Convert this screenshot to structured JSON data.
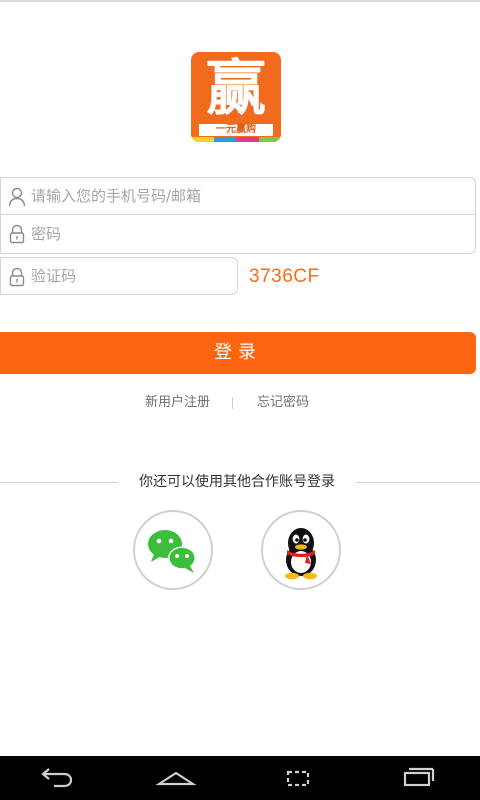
{
  "logo": {
    "char": "赢",
    "subtitle": "一元赢购",
    "color": "#f26b1d",
    "stripe_colors": [
      "#f7d51c",
      "#1fa3e0",
      "#e53a8a",
      "#8bc34a"
    ]
  },
  "form": {
    "username_placeholder": "请输入您的手机号码/邮箱",
    "password_placeholder": "密码",
    "captcha_placeholder": "验证码",
    "captcha_code": "3736CF",
    "login_label": "登录"
  },
  "links": {
    "register": "新用户注册",
    "divider": "|",
    "forgot": "忘记密码"
  },
  "other_login": {
    "text": "你还可以使用其他合作账号登录",
    "providers": [
      "wechat-icon",
      "qq-icon"
    ]
  },
  "icons": {
    "user": "user-icon",
    "lock": "lock-icon"
  },
  "navbar": [
    "back-icon",
    "home-icon",
    "recents-icon",
    "menu-icon"
  ],
  "colors": {
    "accent": "#ff6411",
    "captcha": "#ff6a13",
    "wechat": "#3dbd3c"
  }
}
